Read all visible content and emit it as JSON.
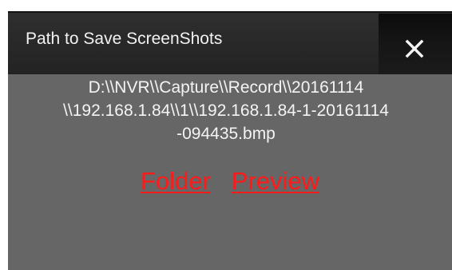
{
  "dialog": {
    "title": "Path to Save ScreenShots",
    "close_icon": "close-icon"
  },
  "path": {
    "line1": "D:\\\\NVR\\\\Capture\\\\Record\\\\20161114",
    "line2": "\\\\192.168.1.84\\\\1\\\\192.168.1.84-1-20161114",
    "line3": "-094435.bmp"
  },
  "links": {
    "folder": "Folder",
    "preview": "Preview"
  },
  "colors": {
    "title_bar": "#282828",
    "close_button": "#151515",
    "panel": "#666666",
    "text": "#f4f4f4",
    "link": "#ff1a1a"
  }
}
